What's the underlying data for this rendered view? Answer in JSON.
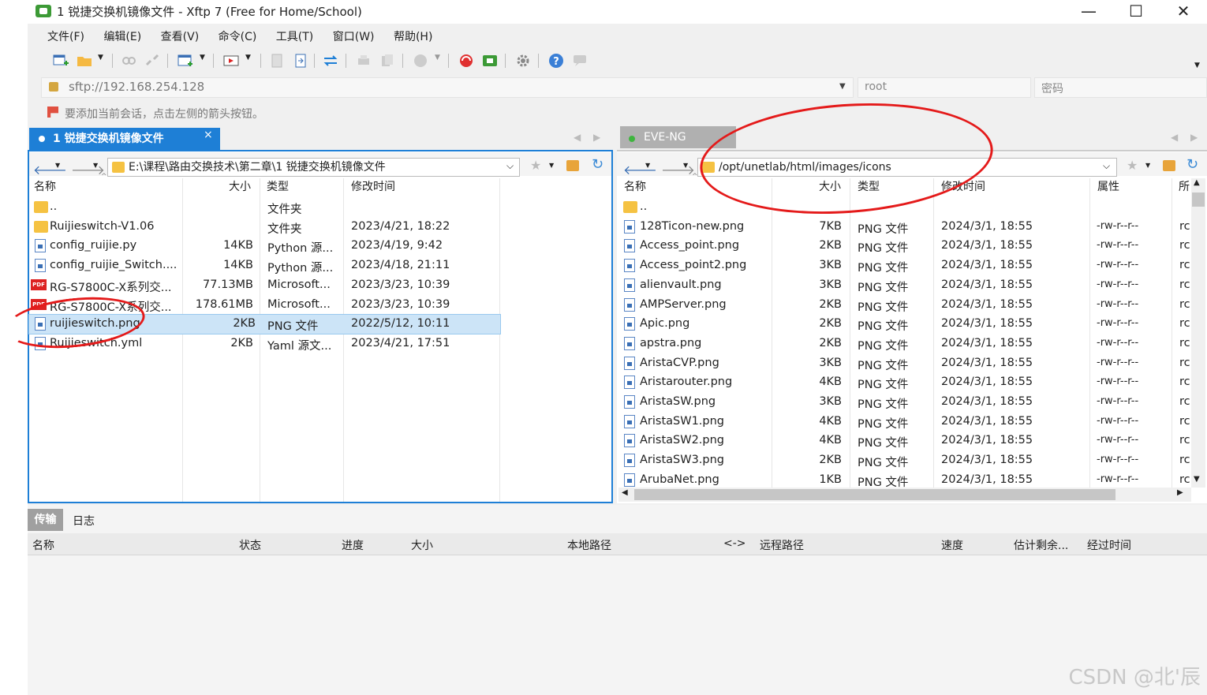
{
  "window": {
    "title": "1 锐捷交换机镜像文件 - Xftp 7 (Free for Home/School)",
    "minimize_glyph": "—",
    "maximize_glyph": "☐",
    "close_glyph": "✕"
  },
  "menu": [
    "文件(F)",
    "编辑(E)",
    "查看(V)",
    "命令(C)",
    "工具(T)",
    "窗口(W)",
    "帮助(H)"
  ],
  "address": {
    "host": "sftp://192.168.254.128",
    "user_placeholder": "root",
    "password_placeholder": "密码",
    "hint": "要添加当前会话，点击左侧的箭头按钮。"
  },
  "left_tab": {
    "label": "1 锐捷交换机镜像文件",
    "close": "×"
  },
  "right_tab": {
    "label": "EVE-NG"
  },
  "left_pane": {
    "path": "E:\\课程\\路由交换技术\\第二章\\1 锐捷交换机镜像文件",
    "columns": [
      "名称",
      "大小",
      "类型",
      "修改时间"
    ],
    "rows": [
      {
        "icon": "folder-icon",
        "name": "..",
        "size": "",
        "type": "文件夹",
        "mtime": ""
      },
      {
        "icon": "folder-icon",
        "name": "Ruijieswitch-V1.06",
        "size": "",
        "type": "文件夹",
        "mtime": "2023/4/21, 18:22"
      },
      {
        "icon": "file-icon",
        "name": "config_ruijie.py",
        "size": "14KB",
        "type": "Python 源...",
        "mtime": "2023/4/19, 9:42"
      },
      {
        "icon": "file-icon",
        "name": "config_ruijie_Switch....",
        "size": "14KB",
        "type": "Python 源...",
        "mtime": "2023/4/18, 21:11"
      },
      {
        "icon": "pdf-icon",
        "name": "RG-S7800C-X系列交...",
        "size": "77.13MB",
        "type": "Microsoft...",
        "mtime": "2023/3/23, 10:39"
      },
      {
        "icon": "pdf-icon",
        "name": "RG-S7800C-X系列交...",
        "size": "178.61MB",
        "type": "Microsoft...",
        "mtime": "2023/3/23, 10:39"
      },
      {
        "icon": "file-icon",
        "name": "ruijieswitch.png",
        "size": "2KB",
        "type": "PNG 文件",
        "mtime": "2022/5/12, 10:11"
      },
      {
        "icon": "file-icon",
        "name": "Ruijieswitch.yml",
        "size": "2KB",
        "type": "Yaml 源文...",
        "mtime": "2023/4/21, 17:51"
      }
    ]
  },
  "right_pane": {
    "path": "/opt/unetlab/html/images/icons",
    "columns": [
      "名称",
      "大小",
      "类型",
      "修改时间",
      "属性",
      "所"
    ],
    "rows": [
      {
        "name": "..",
        "size": "",
        "type": "",
        "mtime": "",
        "attr": "",
        "owner": ""
      },
      {
        "name": "128Ticon-new.png",
        "size": "7KB",
        "type": "PNG 文件",
        "mtime": "2024/3/1, 18:55",
        "attr": "-rw-r--r--",
        "owner": "rc"
      },
      {
        "name": "Access_point.png",
        "size": "2KB",
        "type": "PNG 文件",
        "mtime": "2024/3/1, 18:55",
        "attr": "-rw-r--r--",
        "owner": "rc"
      },
      {
        "name": "Access_point2.png",
        "size": "3KB",
        "type": "PNG 文件",
        "mtime": "2024/3/1, 18:55",
        "attr": "-rw-r--r--",
        "owner": "rc"
      },
      {
        "name": "alienvault.png",
        "size": "3KB",
        "type": "PNG 文件",
        "mtime": "2024/3/1, 18:55",
        "attr": "-rw-r--r--",
        "owner": "rc"
      },
      {
        "name": "AMPServer.png",
        "size": "2KB",
        "type": "PNG 文件",
        "mtime": "2024/3/1, 18:55",
        "attr": "-rw-r--r--",
        "owner": "rc"
      },
      {
        "name": "Apic.png",
        "size": "2KB",
        "type": "PNG 文件",
        "mtime": "2024/3/1, 18:55",
        "attr": "-rw-r--r--",
        "owner": "rc"
      },
      {
        "name": "apstra.png",
        "size": "2KB",
        "type": "PNG 文件",
        "mtime": "2024/3/1, 18:55",
        "attr": "-rw-r--r--",
        "owner": "rc"
      },
      {
        "name": "AristaCVP.png",
        "size": "3KB",
        "type": "PNG 文件",
        "mtime": "2024/3/1, 18:55",
        "attr": "-rw-r--r--",
        "owner": "rc"
      },
      {
        "name": "Aristarouter.png",
        "size": "4KB",
        "type": "PNG 文件",
        "mtime": "2024/3/1, 18:55",
        "attr": "-rw-r--r--",
        "owner": "rc"
      },
      {
        "name": "AristaSW.png",
        "size": "3KB",
        "type": "PNG 文件",
        "mtime": "2024/3/1, 18:55",
        "attr": "-rw-r--r--",
        "owner": "rc"
      },
      {
        "name": "AristaSW1.png",
        "size": "4KB",
        "type": "PNG 文件",
        "mtime": "2024/3/1, 18:55",
        "attr": "-rw-r--r--",
        "owner": "rc"
      },
      {
        "name": "AristaSW2.png",
        "size": "4KB",
        "type": "PNG 文件",
        "mtime": "2024/3/1, 18:55",
        "attr": "-rw-r--r--",
        "owner": "rc"
      },
      {
        "name": "AristaSW3.png",
        "size": "2KB",
        "type": "PNG 文件",
        "mtime": "2024/3/1, 18:55",
        "attr": "-rw-r--r--",
        "owner": "rc"
      },
      {
        "name": "ArubaNet.png",
        "size": "1KB",
        "type": "PNG 文件",
        "mtime": "2024/3/1, 18:55",
        "attr": "-rw-r--r--",
        "owner": "rc"
      }
    ]
  },
  "transfer": {
    "tabs": [
      "传输",
      "日志"
    ],
    "columns": [
      "名称",
      "状态",
      "进度",
      "大小",
      "本地路径",
      "<->",
      "远程路径",
      "速度",
      "估计剩余...",
      "经过时间"
    ]
  },
  "watermark": "CSDN @北'辰",
  "colors": {
    "accent": "#1e7fd6",
    "annotation": "#e41a1a",
    "selection": "#cce4f7"
  }
}
